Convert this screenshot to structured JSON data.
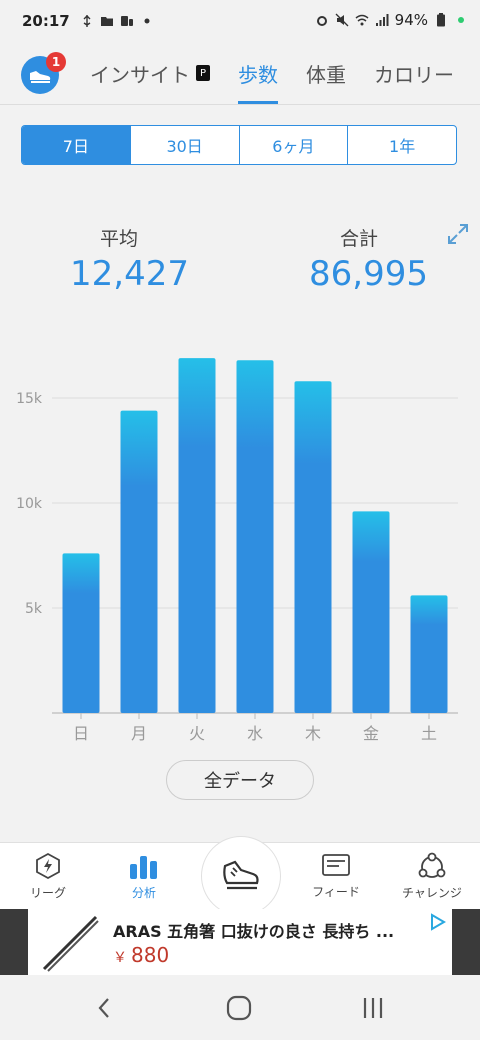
{
  "status": {
    "time": "20:17",
    "battery": "94%"
  },
  "header": {
    "tabs": [
      {
        "label": "インサイト",
        "active": false
      },
      {
        "label": "歩数",
        "active": true
      },
      {
        "label": "体重",
        "active": false
      },
      {
        "label": "カロリー",
        "active": false
      }
    ],
    "notification_count": "1",
    "insight_badge": "P"
  },
  "period": {
    "options": [
      "7日",
      "30日",
      "6ヶ月",
      "1年"
    ],
    "selected": "7日"
  },
  "stats": {
    "average_label": "平均",
    "average_value": "12,427",
    "total_label": "合計",
    "total_value": "86,995"
  },
  "chart_data": {
    "type": "bar",
    "categories": [
      "日",
      "月",
      "火",
      "水",
      "木",
      "金",
      "土"
    ],
    "values": [
      7600,
      14400,
      16900,
      16800,
      15800,
      9600,
      5600
    ],
    "ytick_labels": [
      "5k",
      "10k",
      "15k"
    ],
    "ylim": [
      0,
      18000
    ],
    "grid": true,
    "colors": {
      "bar_top": "#25bfe8",
      "bar_bottom": "#2f8ee0"
    }
  },
  "all_data_label": "全データ",
  "bottom_nav": [
    {
      "label": "リーグ",
      "icon": "league-icon",
      "active": false
    },
    {
      "label": "分析",
      "icon": "analysis-icon",
      "active": true
    },
    {
      "label": "",
      "icon": "shoe-icon",
      "active": false
    },
    {
      "label": "フィード",
      "icon": "feed-icon",
      "active": false
    },
    {
      "label": "チャレンジ",
      "icon": "challenge-icon",
      "active": false
    }
  ],
  "ad": {
    "title": "ARAS 五角箸 口抜けの良さ 長持ち ...",
    "price_symbol": "￥",
    "price": "880"
  },
  "accent_color": "#2f8ee0"
}
